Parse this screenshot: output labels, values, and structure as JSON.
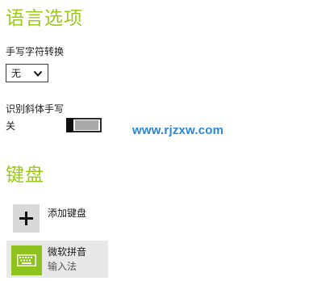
{
  "language_options": {
    "title": "语言选项",
    "handwriting_conversion": {
      "label": "手写字符转换",
      "selected": "无"
    },
    "italic_recognition": {
      "label": "识别斜体手写",
      "state_label": "关",
      "on": false
    }
  },
  "watermark": "www.rjzxw.com",
  "keyboard": {
    "title": "键盘",
    "add_label": "添加键盘",
    "items": [
      {
        "name": "微软拼音",
        "type": "输入法",
        "icon": "keyboard-icon"
      }
    ]
  },
  "colors": {
    "accent_green": "#9cc81c",
    "ime_tile": "#8ec21f",
    "watermark_blue": "#2b86d8"
  }
}
